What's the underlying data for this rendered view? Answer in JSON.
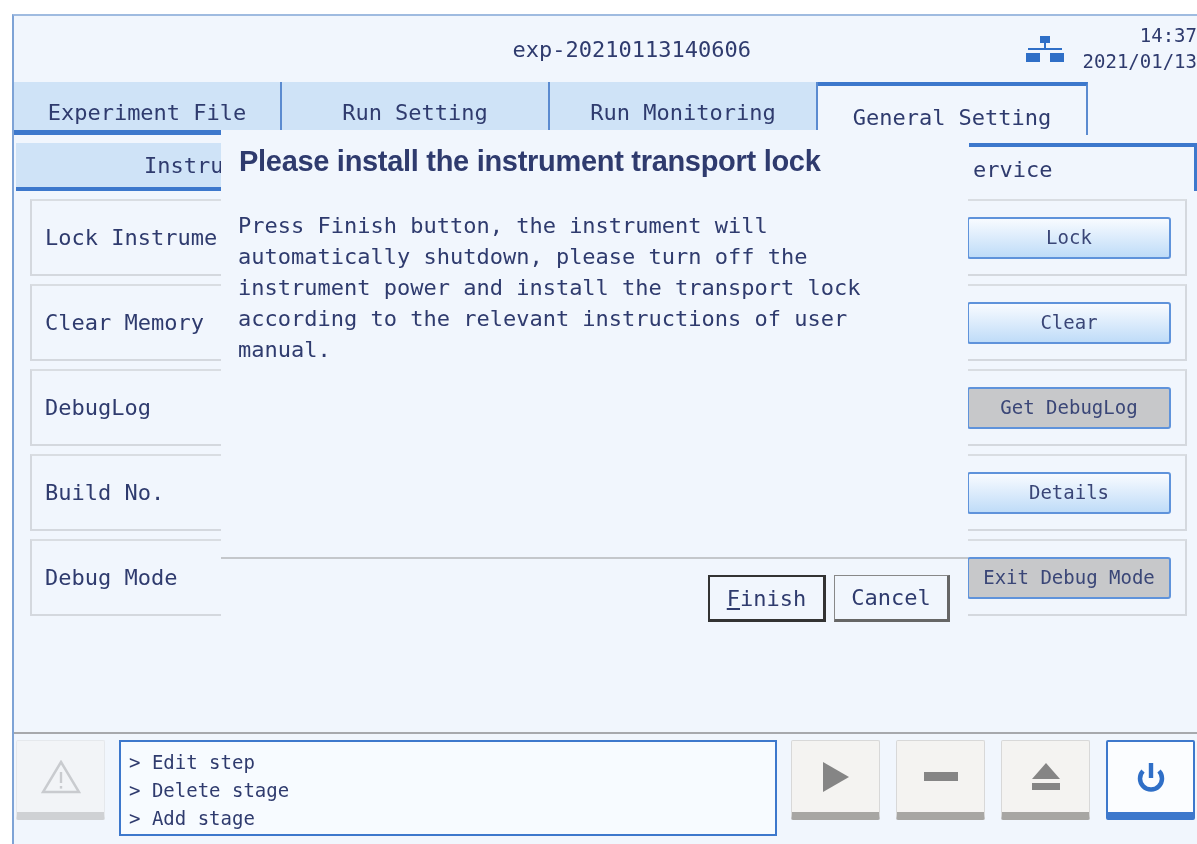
{
  "window": {
    "title": "exp-20210113140606",
    "time": "14:37",
    "date": "2021/01/13"
  },
  "tabs": [
    {
      "label": "Experiment File",
      "selected": false
    },
    {
      "label": "Run Setting",
      "selected": false
    },
    {
      "label": "Run Monitoring",
      "selected": false
    },
    {
      "label": "General Setting",
      "selected": true
    }
  ],
  "subtabs": [
    {
      "label": "Instru",
      "selected": false
    },
    {
      "label": "ervice",
      "selected": true
    }
  ],
  "settings": [
    {
      "label": "Lock Instrume",
      "button": "Lock",
      "disabled": false
    },
    {
      "label": "Clear Memory",
      "button": "Clear",
      "disabled": false
    },
    {
      "label": "DebugLog",
      "button": "Get DebugLog",
      "disabled": true
    },
    {
      "label": "Build No.",
      "button": "Details",
      "disabled": false
    },
    {
      "label": "Debug Mode",
      "button": "Exit Debug Mode",
      "disabled": true
    }
  ],
  "dialog": {
    "title": "Please install the instrument transport lock",
    "message": "Press Finish button, the instrument will automatically shutdown, please turn off the instrument power and install the transport lock according to the relevant instructions of user manual.",
    "buttons": [
      {
        "label": "Finish",
        "mnemonic_underlined": true,
        "default": true
      },
      {
        "label": "Cancel",
        "default": false
      }
    ]
  },
  "log": [
    "> Edit step",
    "> Delete stage",
    "> Add stage"
  ],
  "toolbar": [
    {
      "kind": "warning",
      "disabled": true,
      "selected": false
    },
    {
      "kind": "play",
      "disabled": false,
      "selected": false
    },
    {
      "kind": "stop",
      "disabled": false,
      "selected": false
    },
    {
      "kind": "eject",
      "disabled": false,
      "selected": false
    },
    {
      "kind": "power",
      "disabled": false,
      "selected": true
    }
  ]
}
